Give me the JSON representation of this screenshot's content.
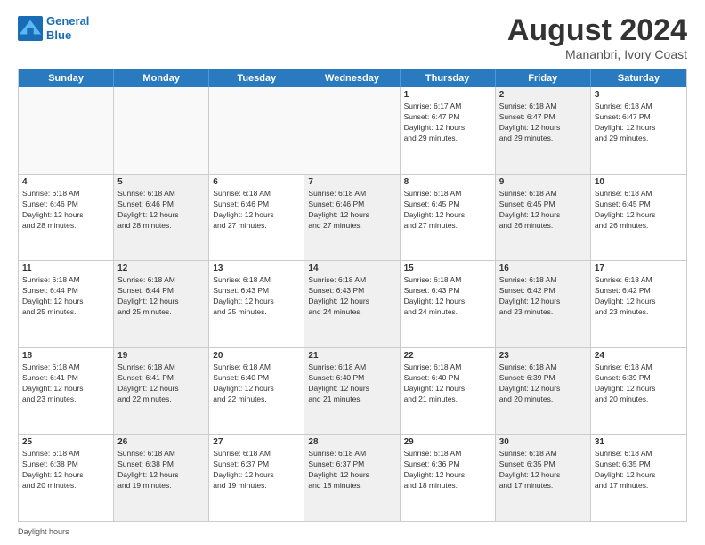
{
  "header": {
    "logo_line1": "General",
    "logo_line2": "Blue",
    "month": "August 2024",
    "location": "Mananbri, Ivory Coast"
  },
  "weekdays": [
    "Sunday",
    "Monday",
    "Tuesday",
    "Wednesday",
    "Thursday",
    "Friday",
    "Saturday"
  ],
  "rows": [
    [
      {
        "day": "",
        "info": "",
        "shaded": false,
        "empty": true
      },
      {
        "day": "",
        "info": "",
        "shaded": false,
        "empty": true
      },
      {
        "day": "",
        "info": "",
        "shaded": false,
        "empty": true
      },
      {
        "day": "",
        "info": "",
        "shaded": false,
        "empty": true
      },
      {
        "day": "1",
        "info": "Sunrise: 6:17 AM\nSunset: 6:47 PM\nDaylight: 12 hours\nand 29 minutes.",
        "shaded": false,
        "empty": false
      },
      {
        "day": "2",
        "info": "Sunrise: 6:18 AM\nSunset: 6:47 PM\nDaylight: 12 hours\nand 29 minutes.",
        "shaded": true,
        "empty": false
      },
      {
        "day": "3",
        "info": "Sunrise: 6:18 AM\nSunset: 6:47 PM\nDaylight: 12 hours\nand 29 minutes.",
        "shaded": false,
        "empty": false
      }
    ],
    [
      {
        "day": "4",
        "info": "Sunrise: 6:18 AM\nSunset: 6:46 PM\nDaylight: 12 hours\nand 28 minutes.",
        "shaded": false,
        "empty": false
      },
      {
        "day": "5",
        "info": "Sunrise: 6:18 AM\nSunset: 6:46 PM\nDaylight: 12 hours\nand 28 minutes.",
        "shaded": true,
        "empty": false
      },
      {
        "day": "6",
        "info": "Sunrise: 6:18 AM\nSunset: 6:46 PM\nDaylight: 12 hours\nand 27 minutes.",
        "shaded": false,
        "empty": false
      },
      {
        "day": "7",
        "info": "Sunrise: 6:18 AM\nSunset: 6:46 PM\nDaylight: 12 hours\nand 27 minutes.",
        "shaded": true,
        "empty": false
      },
      {
        "day": "8",
        "info": "Sunrise: 6:18 AM\nSunset: 6:45 PM\nDaylight: 12 hours\nand 27 minutes.",
        "shaded": false,
        "empty": false
      },
      {
        "day": "9",
        "info": "Sunrise: 6:18 AM\nSunset: 6:45 PM\nDaylight: 12 hours\nand 26 minutes.",
        "shaded": true,
        "empty": false
      },
      {
        "day": "10",
        "info": "Sunrise: 6:18 AM\nSunset: 6:45 PM\nDaylight: 12 hours\nand 26 minutes.",
        "shaded": false,
        "empty": false
      }
    ],
    [
      {
        "day": "11",
        "info": "Sunrise: 6:18 AM\nSunset: 6:44 PM\nDaylight: 12 hours\nand 25 minutes.",
        "shaded": false,
        "empty": false
      },
      {
        "day": "12",
        "info": "Sunrise: 6:18 AM\nSunset: 6:44 PM\nDaylight: 12 hours\nand 25 minutes.",
        "shaded": true,
        "empty": false
      },
      {
        "day": "13",
        "info": "Sunrise: 6:18 AM\nSunset: 6:43 PM\nDaylight: 12 hours\nand 25 minutes.",
        "shaded": false,
        "empty": false
      },
      {
        "day": "14",
        "info": "Sunrise: 6:18 AM\nSunset: 6:43 PM\nDaylight: 12 hours\nand 24 minutes.",
        "shaded": true,
        "empty": false
      },
      {
        "day": "15",
        "info": "Sunrise: 6:18 AM\nSunset: 6:43 PM\nDaylight: 12 hours\nand 24 minutes.",
        "shaded": false,
        "empty": false
      },
      {
        "day": "16",
        "info": "Sunrise: 6:18 AM\nSunset: 6:42 PM\nDaylight: 12 hours\nand 23 minutes.",
        "shaded": true,
        "empty": false
      },
      {
        "day": "17",
        "info": "Sunrise: 6:18 AM\nSunset: 6:42 PM\nDaylight: 12 hours\nand 23 minutes.",
        "shaded": false,
        "empty": false
      }
    ],
    [
      {
        "day": "18",
        "info": "Sunrise: 6:18 AM\nSunset: 6:41 PM\nDaylight: 12 hours\nand 23 minutes.",
        "shaded": false,
        "empty": false
      },
      {
        "day": "19",
        "info": "Sunrise: 6:18 AM\nSunset: 6:41 PM\nDaylight: 12 hours\nand 22 minutes.",
        "shaded": true,
        "empty": false
      },
      {
        "day": "20",
        "info": "Sunrise: 6:18 AM\nSunset: 6:40 PM\nDaylight: 12 hours\nand 22 minutes.",
        "shaded": false,
        "empty": false
      },
      {
        "day": "21",
        "info": "Sunrise: 6:18 AM\nSunset: 6:40 PM\nDaylight: 12 hours\nand 21 minutes.",
        "shaded": true,
        "empty": false
      },
      {
        "day": "22",
        "info": "Sunrise: 6:18 AM\nSunset: 6:40 PM\nDaylight: 12 hours\nand 21 minutes.",
        "shaded": false,
        "empty": false
      },
      {
        "day": "23",
        "info": "Sunrise: 6:18 AM\nSunset: 6:39 PM\nDaylight: 12 hours\nand 20 minutes.",
        "shaded": true,
        "empty": false
      },
      {
        "day": "24",
        "info": "Sunrise: 6:18 AM\nSunset: 6:39 PM\nDaylight: 12 hours\nand 20 minutes.",
        "shaded": false,
        "empty": false
      }
    ],
    [
      {
        "day": "25",
        "info": "Sunrise: 6:18 AM\nSunset: 6:38 PM\nDaylight: 12 hours\nand 20 minutes.",
        "shaded": false,
        "empty": false
      },
      {
        "day": "26",
        "info": "Sunrise: 6:18 AM\nSunset: 6:38 PM\nDaylight: 12 hours\nand 19 minutes.",
        "shaded": true,
        "empty": false
      },
      {
        "day": "27",
        "info": "Sunrise: 6:18 AM\nSunset: 6:37 PM\nDaylight: 12 hours\nand 19 minutes.",
        "shaded": false,
        "empty": false
      },
      {
        "day": "28",
        "info": "Sunrise: 6:18 AM\nSunset: 6:37 PM\nDaylight: 12 hours\nand 18 minutes.",
        "shaded": true,
        "empty": false
      },
      {
        "day": "29",
        "info": "Sunrise: 6:18 AM\nSunset: 6:36 PM\nDaylight: 12 hours\nand 18 minutes.",
        "shaded": false,
        "empty": false
      },
      {
        "day": "30",
        "info": "Sunrise: 6:18 AM\nSunset: 6:35 PM\nDaylight: 12 hours\nand 17 minutes.",
        "shaded": true,
        "empty": false
      },
      {
        "day": "31",
        "info": "Sunrise: 6:18 AM\nSunset: 6:35 PM\nDaylight: 12 hours\nand 17 minutes.",
        "shaded": false,
        "empty": false
      }
    ]
  ],
  "footer": "Daylight hours"
}
